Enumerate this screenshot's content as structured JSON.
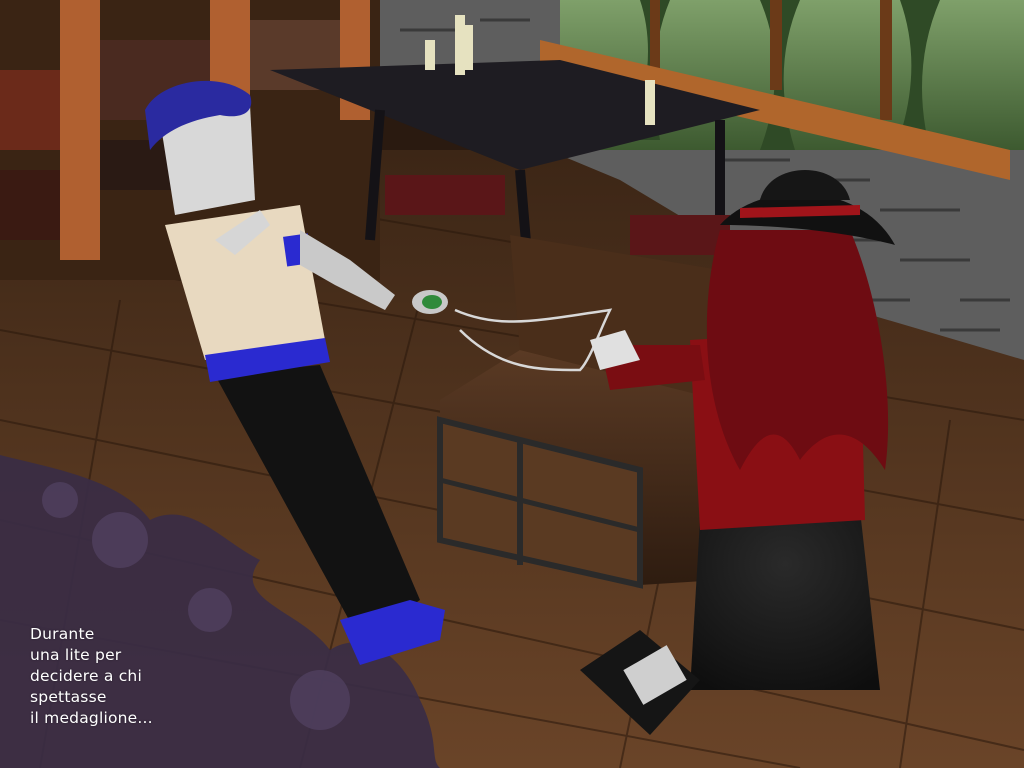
{
  "caption": {
    "lines": [
      "Durante",
      "una lite per",
      "decidere a chi",
      "spettasse",
      "il medaglione..."
    ]
  },
  "colors": {
    "floor": "#5a3a22",
    "stone_wall": "#6b6b6b",
    "shirt": "#e8d9c0",
    "trim_blue": "#2a2ad0",
    "dress_red": "#8a0f14",
    "hair_red": "#7a0d12",
    "ink_splash": "#3a2c45",
    "caption_text": "#ffffff"
  },
  "scene": {
    "subjects": [
      "boy-figure",
      "girl-figure",
      "treasure-chest",
      "medallion-necklace",
      "bookshelf",
      "table",
      "candles",
      "window"
    ]
  }
}
